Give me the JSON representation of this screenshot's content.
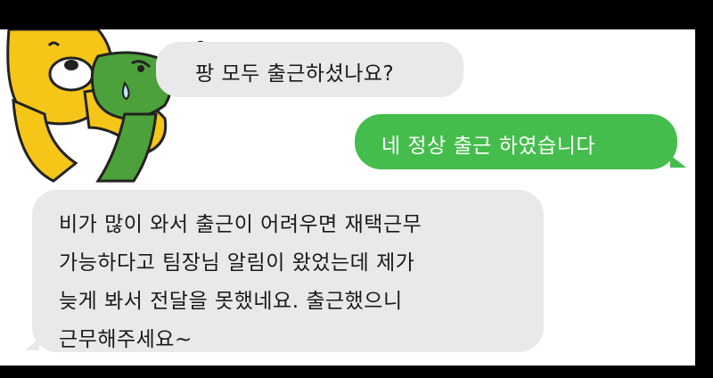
{
  "messages": [
    {
      "id": "b1",
      "direction": "incoming",
      "lines": [
        "팡 모두 출근하셨나요?"
      ]
    },
    {
      "id": "b2",
      "direction": "outgoing",
      "lines": [
        "네 정상 출근 하였습니다"
      ]
    },
    {
      "id": "b3",
      "direction": "incoming",
      "lines": [
        "비가 많이 와서 출근이 어려우면 재택근무",
        "가능하다고 팀장님 알림이 왔었는데 제가",
        "늦게 봐서 전달을 못했네요. 출근했으니",
        "근무해주세요~"
      ]
    }
  ],
  "colors": {
    "incoming_bubble": "#e9e9e9",
    "outgoing_bubble": "#45bd4c",
    "sticker_yellow": "#f5c518",
    "sticker_green": "#4da13a"
  },
  "sticker": {
    "name": "yellow-lion-hugging-crying-green-character"
  }
}
